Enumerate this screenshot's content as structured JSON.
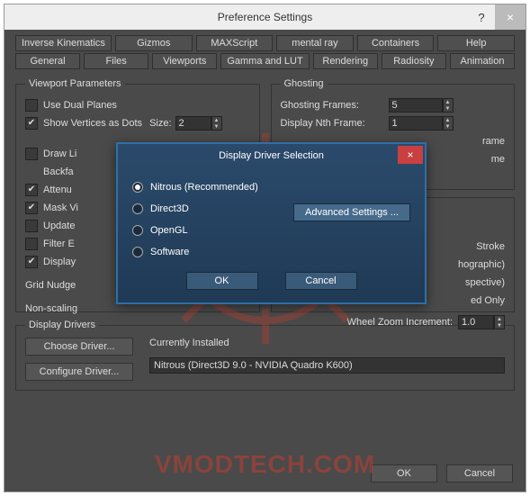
{
  "titlebar": {
    "title": "Preference Settings",
    "help": "?",
    "close": "×"
  },
  "tabs": {
    "row1": [
      "Inverse Kinematics",
      "Gizmos",
      "MAXScript",
      "mental ray",
      "Containers",
      "Help"
    ],
    "row2": [
      "General",
      "Files",
      "Viewports",
      "Gamma and LUT",
      "Rendering",
      "Radiosity",
      "Animation"
    ]
  },
  "viewport": {
    "legend": "Viewport Parameters",
    "useDual": "Use Dual Planes",
    "showVerts": "Show Vertices as Dots",
    "sizeLabel": "Size:",
    "sizeVal": "2",
    "drawLi": "Draw Li",
    "backfa": "Backfa",
    "attenu": "Attenu",
    "maskVi": "Mask Vi",
    "update": "Update",
    "filterE": "Filter E",
    "display": "Display",
    "gridNudge": "Grid Nudge",
    "nonScaling": "Non-scaling"
  },
  "ghosting": {
    "legend": "Ghosting",
    "framesLabel": "Ghosting Frames:",
    "framesVal": "5",
    "nthLabel": "Display Nth Frame:",
    "nthVal": "1",
    "rame": "rame",
    "me": "me"
  },
  "rightPartial": {
    "stroke": "Stroke",
    "hographic": "hographic)",
    "spective": "spective)",
    "edOnly": "ed Only",
    "wheelLabel": "Wheel Zoom Increment:",
    "wheelVal": "1.0"
  },
  "drivers": {
    "legend": "Display Drivers",
    "choose": "Choose Driver...",
    "configure": "Configure Driver...",
    "currently": "Currently Installed",
    "installed": "Nitrous (Direct3D 9.0 - NVIDIA Quadro K600)"
  },
  "bottom": {
    "ok": "OK",
    "cancel": "Cancel"
  },
  "modal": {
    "title": "Display Driver Selection",
    "close": "×",
    "nitrous": "Nitrous (Recommended)",
    "d3d": "Direct3D",
    "opengl": "OpenGL",
    "software": "Software",
    "adv": "Advanced Settings ...",
    "ok": "OK",
    "cancel": "Cancel"
  },
  "watermark": "VMODTECH.COM"
}
